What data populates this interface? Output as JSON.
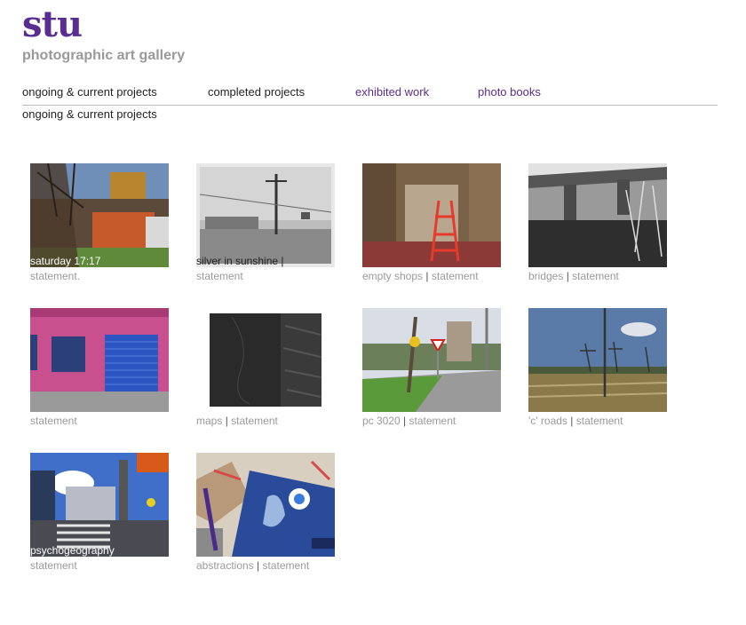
{
  "site": {
    "logo": "stu",
    "tagline": "photographic art gallery"
  },
  "nav": [
    {
      "label": "ongoing & current projects"
    },
    {
      "label": "completed projects"
    },
    {
      "label": "exhibited work"
    },
    {
      "label": "photo books"
    }
  ],
  "current_section": "ongoing & current projects",
  "separator": "|",
  "gallery": [
    {
      "overlay": "saturday 17:17",
      "title": "",
      "statement": "statement."
    },
    {
      "overlay": "silver in sunshine |",
      "title": "",
      "statement": "statement"
    },
    {
      "overlay": "",
      "title": "empty shops",
      "statement": "statement"
    },
    {
      "overlay": "",
      "title": "bridges",
      "statement": "statement"
    },
    {
      "overlay": "",
      "title": "",
      "statement": "statement"
    },
    {
      "overlay": "",
      "title": "maps",
      "statement": "statement"
    },
    {
      "overlay": "",
      "title": "pc 3020",
      "statement": "statement"
    },
    {
      "overlay": "",
      "title": "'c' roads",
      "statement": "statement"
    },
    {
      "overlay": "psychogeography",
      "title": "",
      "statement": "statement"
    },
    {
      "overlay": "",
      "title": "abstractions",
      "statement": "statement"
    }
  ]
}
